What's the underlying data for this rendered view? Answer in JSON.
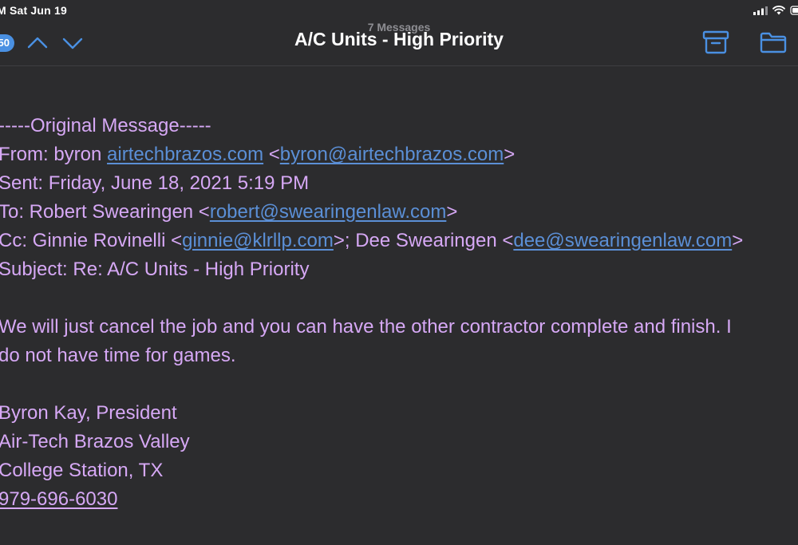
{
  "status_bar": {
    "time": "M   Sat Jun 19"
  },
  "nav": {
    "unread_count": "50",
    "message_count": "7 Messages",
    "title": "A/C Units - High Priority",
    "accent_color": "#4a90e2"
  },
  "message": {
    "header_divider": "-----Original Message-----",
    "from": {
      "label": "From: byron ",
      "name_link": "airtechbrazos.com",
      "open": " <",
      "email": "byron@airtechbrazos.com",
      "close": ">"
    },
    "sent": "Sent: Friday, June 18, 2021 5:19 PM",
    "to": {
      "label": "To: Robert Swearingen <",
      "email": "robert@swearingenlaw.com",
      "close": ">"
    },
    "cc": {
      "label": "Cc: Ginnie Rovinelli <",
      "email1": "ginnie@klrllp.com",
      "middle": ">; Dee Swearingen <",
      "email2": "dee@swearingenlaw.com",
      "close": ">"
    },
    "subject": "Subject: Re: A/C Units - High Priority",
    "body_line1": "We will just cancel the job and you can have the other contractor complete and finish. I",
    "body_line2": "do not have time for games.",
    "signature": {
      "name": "Byron Kay, President",
      "company": "Air-Tech Brazos Valley",
      "location": "College Station, TX",
      "phone": "979-696-6030"
    },
    "text_color": "#d6a8f5",
    "link_color": "#5b8fd6"
  }
}
